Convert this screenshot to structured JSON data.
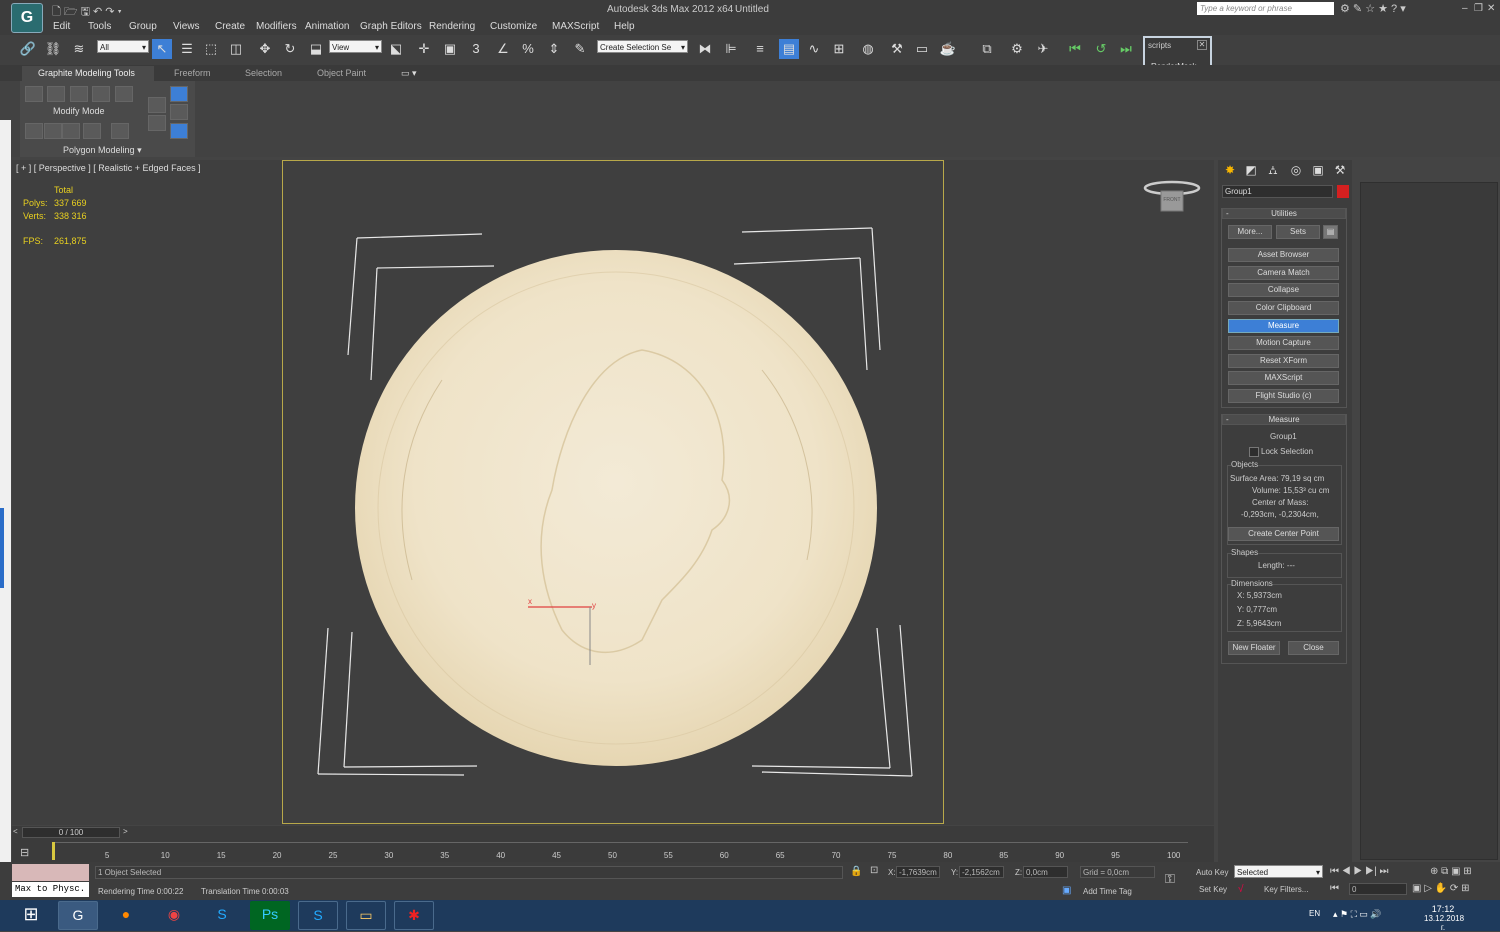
{
  "window": {
    "app_title": "Autodesk 3ds Max 2012 x64",
    "doc_title": "Untitled",
    "search_placeholder": "Type a keyword or phrase"
  },
  "menu": [
    "Edit",
    "Tools",
    "Group",
    "Views",
    "Create",
    "Modifiers",
    "Animation",
    "Graph Editors",
    "Rendering",
    "Customize",
    "MAXScript",
    "Help"
  ],
  "toolbar": {
    "selection_filter": "All",
    "ref_coord": "View",
    "named_selection": "Create Selection Se",
    "snaps_label": "3",
    "scripts_title": "scripts",
    "scripts_item": "RenderMask"
  },
  "ribbon": {
    "tabs": [
      "Graphite Modeling Tools",
      "Freeform",
      "Selection",
      "Object Paint"
    ],
    "mode_label": "Modify Mode",
    "panel_label": "Polygon Modeling"
  },
  "viewport": {
    "label": "[ + ] [ Perspective ] [ Realistic + Edged Faces ]",
    "stats_header": "Total",
    "polys_label": "Polys:",
    "polys_value": "337 669",
    "verts_label": "Verts:",
    "verts_value": "338 316",
    "fps_label": "FPS:",
    "fps_value": "261,875",
    "gizmo_x": "x",
    "gizmo_y": "y",
    "viewcube_label": "FRONT"
  },
  "command_panel": {
    "object_name": "Group1",
    "object_color": "#d42020",
    "utilities_title": "Utilities",
    "more_btn": "More...",
    "sets_btn": "Sets",
    "utility_buttons": [
      "Asset Browser",
      "Camera Match",
      "Collapse",
      "Color Clipboard",
      "Measure",
      "Motion Capture",
      "Reset XForm",
      "MAXScript",
      "Flight Studio (c)"
    ],
    "active_utility": "Measure",
    "measure": {
      "title": "Measure",
      "object": "Group1",
      "lock_selection": "Lock Selection",
      "objects_group": "Objects",
      "surface_area": "Surface Area:  79,19 sq cm",
      "volume": "Volume:  15,53³ cu cm",
      "center_of_mass": "Center of Mass:",
      "com_value": "-0,293cm, -0,2304cm,",
      "create_center": "Create Center Point",
      "shapes_group": "Shapes",
      "length": "Length:  ---",
      "dimensions_group": "Dimensions",
      "dim_x": "X:   5,9373cm",
      "dim_y": "Y:   0,777cm",
      "dim_z": "Z:   5,9643cm",
      "new_floater": "New Floater",
      "close": "Close"
    }
  },
  "timeline": {
    "frame": "0 / 100",
    "ticks": [
      "5",
      "10",
      "15",
      "20",
      "25",
      "30",
      "35",
      "40",
      "45",
      "50",
      "55",
      "60",
      "65",
      "70",
      "75",
      "80",
      "85",
      "90",
      "95",
      "100"
    ]
  },
  "status": {
    "maxscript_mini": "Max to Physc.",
    "selected_text": "1 Object Selected",
    "render_time": "Rendering Time  0:00:22",
    "translation_time": "Translation Time  0:00:03",
    "x_value": "-1,7639cm",
    "y_value": "-2,1562cm",
    "z_value": "0,0cm",
    "grid": "Grid = 0,0cm",
    "add_time_tag": "Add Time Tag",
    "auto_key": "Auto Key",
    "set_key": "Set Key",
    "selected_combo": "Selected",
    "key_filters": "Key Filters...",
    "frame_field": "0"
  },
  "taskbar": {
    "lang": "EN",
    "time": "17:12",
    "date": "13.12.2018 г."
  }
}
